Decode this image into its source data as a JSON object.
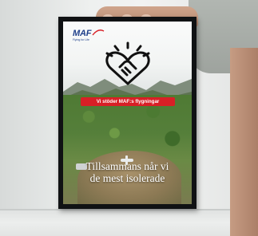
{
  "poster": {
    "logo": {
      "name": "MAF",
      "tagline": "Flying for Life"
    },
    "badge_text": "Vi stöder MAF:s flygningar",
    "headline_line1": "Tillsammans når vi",
    "headline_line2": "de mest isolerade",
    "icon": "heart-handshake-icon"
  },
  "colors": {
    "badge": "#d81f26",
    "logo_blue": "#1f3f8a",
    "frame": "#101214"
  }
}
